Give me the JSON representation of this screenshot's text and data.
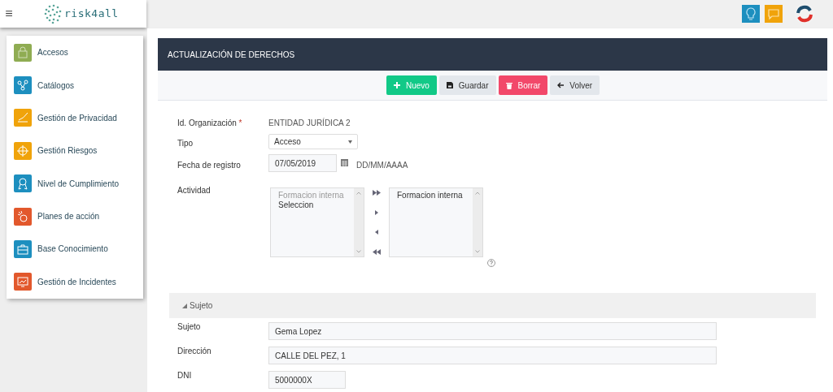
{
  "header": {
    "logo_text": "risk4all",
    "menu_icon": "≡"
  },
  "sidebar": {
    "items": [
      {
        "label": "Accesos",
        "color": "#8fac52"
      },
      {
        "label": "Catálogos",
        "color": "#1d8fbf"
      },
      {
        "label": "Gestión de Privacidad",
        "color": "#f0a30a"
      },
      {
        "label": "Gestión Riesgos",
        "color": "#f0a30a"
      },
      {
        "label": "Nivel de Cumplimiento",
        "color": "#1d8fbf"
      },
      {
        "label": "Planes de acción",
        "color": "#e2582c"
      },
      {
        "label": "Base Conocimiento",
        "color": "#1d8fbf"
      },
      {
        "label": "Gestión de Incidentes",
        "color": "#e2582c"
      }
    ]
  },
  "panel": {
    "title": "ACTUALIZACIÓN DE DERECHOS",
    "buttons": [
      {
        "label": "Nuevo",
        "kind": "new"
      },
      {
        "label": "Guardar",
        "kind": "save"
      },
      {
        "label": "Borrar",
        "kind": "delete"
      },
      {
        "label": "Volver",
        "kind": "back"
      }
    ]
  },
  "form": {
    "organization": {
      "label": "Id. Organización",
      "required_mark": "*",
      "value": "ENTIDAD JURÍDICA 2"
    },
    "type": {
      "label": "Tipo",
      "value": "Acceso"
    },
    "date": {
      "label": "Fecha de registro",
      "value": "07/05/2019",
      "format_hint": "DD/MM/AAAA"
    },
    "activity": {
      "label": "Actividad",
      "available": [
        {
          "label": "Formacion interna",
          "disabled": true
        },
        {
          "label": "Seleccion",
          "disabled": false
        }
      ],
      "chosen": [
        {
          "label": "Formacion interna",
          "disabled": false
        }
      ]
    }
  },
  "subject_section": {
    "title": "Sujeto",
    "expanded": true,
    "fields": [
      {
        "label": "Sujeto",
        "value": "Gema Lopez",
        "kind": "wide"
      },
      {
        "label": "Dirección",
        "value": "CALLE DEL PEZ, 1",
        "kind": "wide"
      },
      {
        "label": "DNI",
        "value": "5000000X",
        "kind": "short"
      }
    ]
  }
}
